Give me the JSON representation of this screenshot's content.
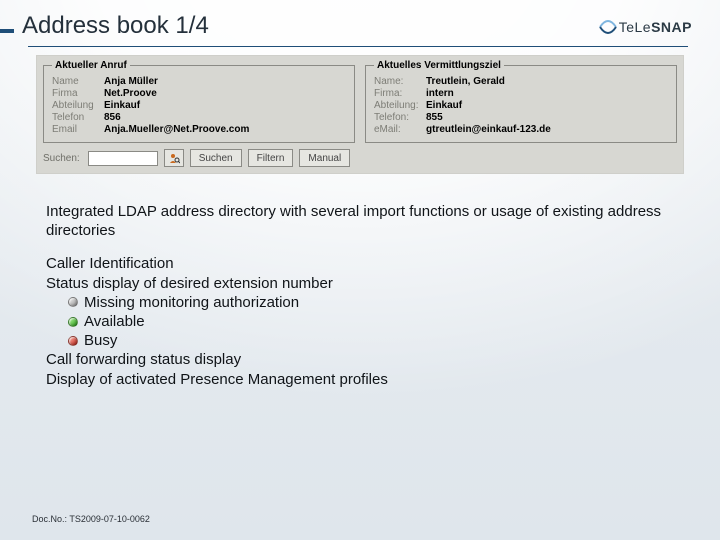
{
  "header": {
    "title": "Address book 1/4",
    "logo_text_light": "TeLe",
    "logo_text_bold": "SNAP"
  },
  "panel": {
    "left": {
      "legend": "Aktueller Anruf",
      "rows": [
        {
          "label": "Name",
          "value": "Anja Müller"
        },
        {
          "label": "Firma",
          "value": "Net.Proove"
        },
        {
          "label": "Abteilung",
          "value": "Einkauf"
        },
        {
          "label": "Telefon",
          "value": "856"
        },
        {
          "label": "Email",
          "value": "Anja.Mueller@Net.Proove.com"
        }
      ]
    },
    "right": {
      "legend": "Aktuelles Vermittlungsziel",
      "rows": [
        {
          "label": "Name:",
          "value": "Treutlein, Gerald"
        },
        {
          "label": "Firma:",
          "value": "intern"
        },
        {
          "label": "Abteilung:",
          "value": "Einkauf"
        },
        {
          "label": "Telefon:",
          "value": "855"
        },
        {
          "label": "eMail:",
          "value": "gtreutlein@einkauf-123.de"
        }
      ]
    },
    "search": {
      "label": "Suchen:",
      "value": "",
      "buttons": [
        "Suchen",
        "Filtern",
        "Manual"
      ]
    }
  },
  "body": {
    "p1": "Integrated LDAP address directory with several import functions or usage of existing address directories",
    "b1": "Caller Identification",
    "b2": "Status display of desired extension number",
    "s1": "Missing monitoring authorization",
    "s2": "Available",
    "s3": "Busy",
    "b3": "Call forwarding status display",
    "b4": "Display of activated Presence Management profiles"
  },
  "footer": {
    "docno": "Doc.No.: TS2009-07-10-0062"
  }
}
